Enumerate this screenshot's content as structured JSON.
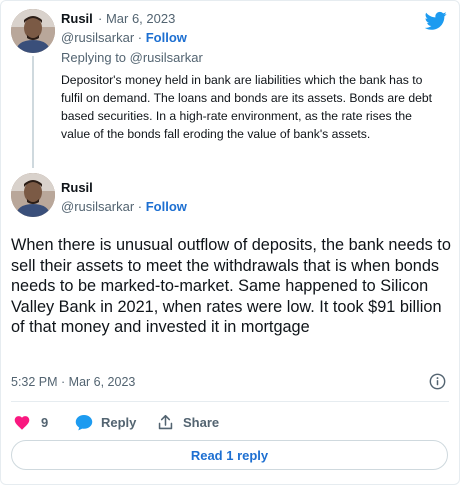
{
  "parent": {
    "name": "Rusil",
    "date": "Mar 6, 2023",
    "handle": "@rusilsarkar",
    "follow_label": "Follow",
    "replying_to": "Replying to @rusilsarkar",
    "text": "Depositor's money held in bank are liabilities which the bank has to fulfil on demand. The loans and bonds are its assets. Bonds are debt based securities. In a high-rate environment, as the rate rises the value of the bonds fall eroding the value of bank's assets."
  },
  "tweet": {
    "name": "Rusil",
    "handle": "@rusilsarkar",
    "follow_label": "Follow",
    "text": "When there is unusual outflow of deposits, the bank needs to sell their assets to meet the withdrawals that is when bonds needs to be marked-to-market. Same happened to Silicon Valley Bank in 2021, when rates were low. It took $91 billion of that money and invested it in mortgage",
    "timestamp": "5:32 PM · Mar 6, 2023"
  },
  "actions": {
    "like_count": "9",
    "reply_label": "Reply",
    "share_label": "Share"
  },
  "read_reply_label": "Read 1 reply",
  "colors": {
    "accent": "#1d6fd1",
    "like": "#f91880",
    "twitter_blue": "#1d9bf0"
  },
  "icons": [
    "twitter-bird-icon",
    "info-icon",
    "heart-icon",
    "reply-bubble-icon",
    "share-icon"
  ]
}
